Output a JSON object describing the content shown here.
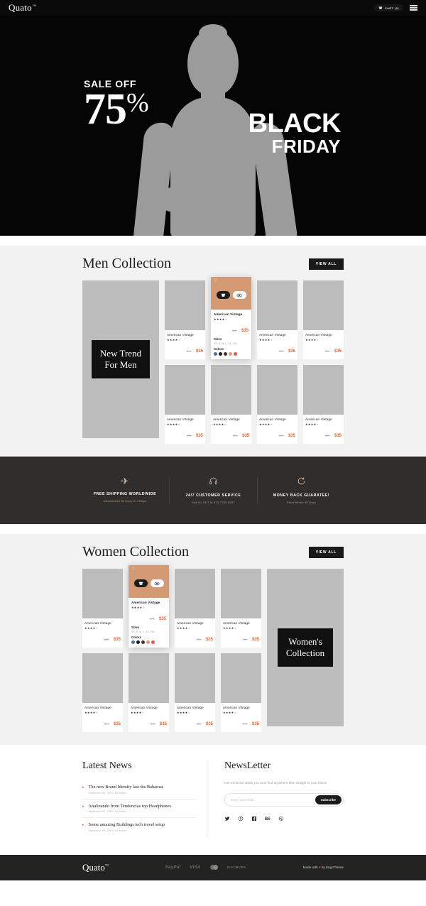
{
  "header": {
    "brand": "Quato",
    "brand_tm": "™",
    "cart_label": "CART (0)",
    "cart_icon": "cart-icon",
    "menu_icon": "hamburger-menu-icon"
  },
  "hero": {
    "sale_off": "SALE OFF",
    "percent_number": "75",
    "percent_symbol": "%",
    "line_black": "BLACK",
    "line_friday": "FRIDAY"
  },
  "men_section": {
    "title": "Men Collection",
    "view_all": "VIEW ALL",
    "promo_line1": "New Trend",
    "promo_line2": "For Men"
  },
  "women_section": {
    "title": "Women Collection",
    "view_all": "VIEW ALL",
    "promo_line1": "Women's",
    "promo_line2": "Collection"
  },
  "product": {
    "name": "American Vintage",
    "old_price": "$70",
    "new_price": "$35",
    "rating_filled": "★★★★",
    "rating_empty": "★",
    "sizes_label": "Sizes",
    "sizes_value": "XS, S, M, L, XL, XXL",
    "colors_label": "Colors",
    "swatches": [
      "#4a6ea8",
      "#1c1c1c",
      "#4a342a",
      "#c9a487",
      "#e05a4e"
    ],
    "wishlist_icon": "heart-icon",
    "add_to_cart_icon": "cart-icon",
    "quick_view_icon": "eye-icon"
  },
  "features": [
    {
      "icon": "airplane-icon",
      "glyph": "✈",
      "title": "FREE SHIPPING WORLDWIDE",
      "subtitle": "Guaranteed Delivery In 4 Days"
    },
    {
      "icon": "headphones-icon",
      "glyph": "🎧",
      "title": "24/7 CUSTOMER SERVICE",
      "subtitle": "Call Us 24/7 At 070-7782-9837"
    },
    {
      "icon": "refresh-icon",
      "glyph": "↻",
      "title": "MONEY BACK GUARATEE!",
      "subtitle": "Send Within 30 Days"
    }
  ],
  "latest_news": {
    "title": "Latest News",
    "items": [
      {
        "title": "The new Brand Identity last the Bahamas",
        "meta": "September  09, 2019  |  by Admin"
      },
      {
        "title": "Analizando from Tendencias top Headphones",
        "meta": "September  09, 2019  |  by Admin"
      },
      {
        "title": "Some amazing Buildings tech travel setup",
        "meta": "September  09, 2019  |  by Admin"
      }
    ]
  },
  "newsletter": {
    "title": "NewsLetter",
    "description": "Get exclusive deals you wont find anywhere else straight to your inbox!",
    "input_placeholder": "Enter your email...",
    "input_value": "",
    "button_label": "Subscribe",
    "socials": [
      {
        "name": "twitter-icon",
        "glyph": "🐦"
      },
      {
        "name": "pinterest-icon",
        "glyph": "Ⓟ"
      },
      {
        "name": "facebook-icon",
        "glyph": "f"
      },
      {
        "name": "behance-icon",
        "glyph": "Bē"
      },
      {
        "name": "dribbble-icon",
        "glyph": "◉"
      }
    ]
  },
  "footer": {
    "brand": "Quato",
    "brand_tm": "™",
    "payments": [
      "PayPal",
      "VISA",
      "mastercard-icon",
      "DISC❋VER"
    ],
    "made_with_pre": "Made with ",
    "made_with_heart": "♥",
    "made_with_post": " by EngoTheme"
  },
  "colors": {
    "accent": "#e8662c",
    "dark": "#1a1a1a",
    "features_bg": "#2f2e2c",
    "hover_card_bg": "#d49a74"
  }
}
